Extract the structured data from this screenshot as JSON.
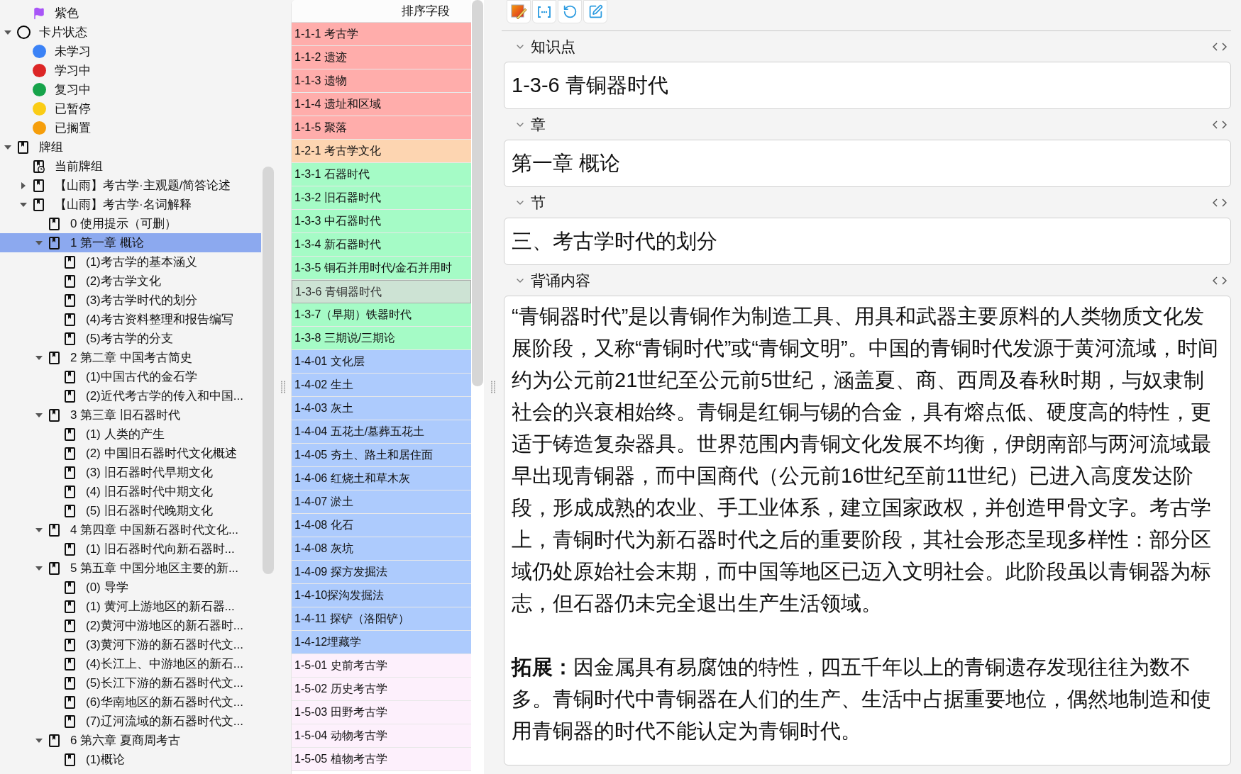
{
  "sidebar": {
    "flag_items": [
      {
        "label": "紫色",
        "kind": "flag",
        "color": "#a855f7",
        "selected": false
      }
    ],
    "tree": [
      {
        "label": "卡片状态",
        "kind": "state_group",
        "expanded": true,
        "selected": false,
        "children": [
          {
            "label": "未学习",
            "kind": "state",
            "color": "#3b82f6",
            "selected": false
          },
          {
            "label": "学习中",
            "kind": "state",
            "color": "#dc2626",
            "selected": false
          },
          {
            "label": "复习中",
            "kind": "state",
            "color": "#16a34a",
            "selected": false
          },
          {
            "label": "已暂停",
            "kind": "state",
            "color": "#facc15",
            "selected": false
          },
          {
            "label": "已搁置",
            "kind": "state",
            "color": "#f59e0b",
            "selected": false
          }
        ]
      },
      {
        "label": "牌组",
        "kind": "deck",
        "expanded": true,
        "selected": false,
        "children": [
          {
            "label": "当前牌组",
            "kind": "current_deck",
            "selected": false
          },
          {
            "label": "【山雨】考古学·主观题/简答论述",
            "kind": "deck",
            "expanded": false,
            "selected": false
          },
          {
            "label": "【山雨】考古学·名词解释",
            "kind": "deck",
            "expanded": true,
            "selected": false,
            "children": [
              {
                "label": "0 使用提示（可删）",
                "kind": "deck",
                "selected": false
              },
              {
                "label": "1 第一章 概论",
                "kind": "deck",
                "expanded": true,
                "selected": true,
                "children": [
                  {
                    "label": "(1)考古学的基本涵义",
                    "kind": "deck",
                    "selected": false
                  },
                  {
                    "label": "(2)考古学文化",
                    "kind": "deck",
                    "selected": false
                  },
                  {
                    "label": "(3)考古学时代的划分",
                    "kind": "deck",
                    "selected": false
                  },
                  {
                    "label": "(4)考古资料整理和报告编写",
                    "kind": "deck",
                    "selected": false
                  },
                  {
                    "label": "(5)考古学的分支",
                    "kind": "deck",
                    "selected": false
                  }
                ]
              },
              {
                "label": "2 第二章 中国考古简史",
                "kind": "deck",
                "expanded": true,
                "selected": false,
                "children": [
                  {
                    "label": "(1)中国古代的金石学",
                    "kind": "deck",
                    "selected": false
                  },
                  {
                    "label": "(2)近代考古学的传入和中国...",
                    "kind": "deck",
                    "selected": false
                  }
                ]
              },
              {
                "label": "3 第三章 旧石器时代",
                "kind": "deck",
                "expanded": true,
                "selected": false,
                "children": [
                  {
                    "label": "(1) 人类的产生",
                    "kind": "deck",
                    "selected": false
                  },
                  {
                    "label": "(2) 中国旧石器时代文化概述",
                    "kind": "deck",
                    "selected": false
                  },
                  {
                    "label": "(3) 旧石器时代早期文化",
                    "kind": "deck",
                    "selected": false
                  },
                  {
                    "label": "(4) 旧石器时代中期文化",
                    "kind": "deck",
                    "selected": false
                  },
                  {
                    "label": "(5) 旧石器时代晚期文化",
                    "kind": "deck",
                    "selected": false
                  }
                ]
              },
              {
                "label": "4 第四章 中国新石器时代文化...",
                "kind": "deck",
                "expanded": true,
                "selected": false,
                "children": [
                  {
                    "label": "(1) 旧石器时代向新石器时...",
                    "kind": "deck",
                    "selected": false
                  }
                ]
              },
              {
                "label": "5 第五章 中国分地区主要的新...",
                "kind": "deck",
                "expanded": true,
                "selected": false,
                "children": [
                  {
                    "label": "(0) 导学",
                    "kind": "deck",
                    "selected": false
                  },
                  {
                    "label": "(1) 黄河上游地区的新石器...",
                    "kind": "deck",
                    "selected": false
                  },
                  {
                    "label": "(2)黄河中游地区的新石器时...",
                    "kind": "deck",
                    "selected": false
                  },
                  {
                    "label": "(3)黄河下游的新石器时代文...",
                    "kind": "deck",
                    "selected": false
                  },
                  {
                    "label": "(4)长江上、中游地区的新石...",
                    "kind": "deck",
                    "selected": false
                  },
                  {
                    "label": "(5)长江下游的新石器时代文...",
                    "kind": "deck",
                    "selected": false
                  },
                  {
                    "label": "(6)华南地区的新石器时代文...",
                    "kind": "deck",
                    "selected": false
                  },
                  {
                    "label": "(7)辽河流域的新石器时代文...",
                    "kind": "deck",
                    "selected": false
                  }
                ]
              },
              {
                "label": "6 第六章 夏商周考古",
                "kind": "deck",
                "expanded": true,
                "selected": false,
                "children": [
                  {
                    "label": "(1)概论",
                    "kind": "deck",
                    "selected": false
                  }
                ]
              }
            ]
          }
        ]
      }
    ]
  },
  "card_list": {
    "column": "排序字段",
    "rows": [
      {
        "text": "1-1-1 考古学",
        "color": "#ffadab",
        "selected": false
      },
      {
        "text": "1-1-2 遗迹",
        "color": "#ffadab",
        "selected": false
      },
      {
        "text": "1-1-3 遗物",
        "color": "#ffadab",
        "selected": false
      },
      {
        "text": "1-1-4 遗址和区域",
        "color": "#ffadab",
        "selected": false
      },
      {
        "text": "1-1-5 聚落",
        "color": "#ffadab",
        "selected": false
      },
      {
        "text": "1-2-1 考古学文化",
        "color": "#fdd5b1",
        "selected": false
      },
      {
        "text": "1-3-1 石器时代",
        "color": "#a5fbc6",
        "selected": false
      },
      {
        "text": "1-3-2 旧石器时代",
        "color": "#a5fbc6",
        "selected": false
      },
      {
        "text": "1-3-3 中石器时代",
        "color": "#a5fbc6",
        "selected": false
      },
      {
        "text": "1-3-4 新石器时代",
        "color": "#a5fbc6",
        "selected": false
      },
      {
        "text": "1-3-5 铜石并用时代/金石并用时",
        "color": "#a5fbc6",
        "selected": false
      },
      {
        "text": "1-3-6 青铜器时代",
        "selected": true
      },
      {
        "text": "1-3-7（早期）铁器时代",
        "color": "#a5fbc6",
        "selected": false
      },
      {
        "text": "1-3-8 三期说/三期论",
        "color": "#a5fbc6",
        "selected": false
      },
      {
        "text": "1-4-01 文化层",
        "color": "#adcbfd",
        "selected": false
      },
      {
        "text": "1-4-02 生土",
        "color": "#adcbfd",
        "selected": false
      },
      {
        "text": "1-4-03 灰土",
        "color": "#adcbfd",
        "selected": false
      },
      {
        "text": "1-4-04 五花土/墓葬五花土",
        "color": "#adcbfd",
        "selected": false
      },
      {
        "text": "1-4-05 夯土、路土和居住面",
        "color": "#adcbfd",
        "selected": false
      },
      {
        "text": "1-4-06 红烧土和草木灰",
        "color": "#adcbfd",
        "selected": false
      },
      {
        "text": "1-4-07 淤土",
        "color": "#adcbfd",
        "selected": false
      },
      {
        "text": "1-4-08 化石",
        "color": "#adcbfd",
        "selected": false
      },
      {
        "text": "1-4-08 灰坑",
        "color": "#adcbfd",
        "selected": false
      },
      {
        "text": "1-4-09 探方发掘法",
        "color": "#adcbfd",
        "selected": false
      },
      {
        "text": "1-4-10探沟发掘法",
        "color": "#adcbfd",
        "selected": false
      },
      {
        "text": "1-4-11 探铲（洛阳铲）",
        "color": "#adcbfd",
        "selected": false
      },
      {
        "text": "1-4-12埋藏学",
        "color": "#adcbfd",
        "selected": false
      },
      {
        "text": "1-5-01 史前考古学",
        "color": "#fdf0fc",
        "selected": false
      },
      {
        "text": "1-5-02 历史考古学",
        "color": "#fdf0fc",
        "selected": false
      },
      {
        "text": "1-5-03 田野考古学",
        "color": "#fdf0fc",
        "selected": false
      },
      {
        "text": "1-5-04 动物考古学",
        "color": "#fdf0fc",
        "selected": false
      },
      {
        "text": "1-5-05 植物考古学",
        "color": "#fdf0fc",
        "selected": false
      }
    ]
  },
  "editor": {
    "fields": [
      {
        "label": "知识点",
        "kind": "single",
        "paragraphs": [
          "1-3-6 青铜器时代"
        ]
      },
      {
        "label": "章",
        "kind": "single",
        "paragraphs": [
          "第一章 概论"
        ]
      },
      {
        "label": "节",
        "kind": "single",
        "paragraphs": [
          "三、考古学时代的划分"
        ]
      },
      {
        "label": "背诵内容",
        "kind": "long",
        "paragraphs": [
          "“青铜器时代”是以青铜作为制造工具、用具和武器主要原料的人类物质文化发展阶段，又称“青铜时代”或“青铜文明”。中国的青铜时代发源于黄河流域，时间约为公元前21世纪至公元前5世纪，涵盖夏、商、西周及春秋时期，与奴隶制社会的兴衰相始终。青铜是红铜与锡的合金，具有熔点低、硬度高的特性，更适于铸造复杂器具。世界范围内青铜文化发展不均衡，伊朗南部与两河流域最早出现青铜器，而中国商代（公元前16世纪至前11世纪）已进入高度发达阶段，形成成熟的农业、手工业体系，建立国家政权，并创造甲骨文字。考古学上，青铜时代为新石器时代之后的重要阶段，其社会形态呈现多样性：部分区域仍处原始社会末期，而中国等地区已迈入文明社会。此阶段虽以青铜器为标志，但石器仍未完全退出生产生活领域。",
          "**拓展：**因金属具有易腐蚀的特性，四五千年以上的青铜遗存发现往往为数不多。青铜时代中青铜器在人们的生产、生活中占据重要地位，偶然地制造和使用青铜器的时代不能认定为青铜时代。"
        ]
      }
    ]
  }
}
